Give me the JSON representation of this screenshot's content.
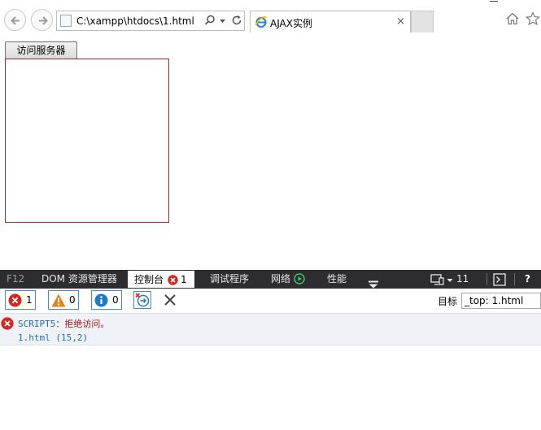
{
  "browser": {
    "address": "C:\\xampp\\htdocs\\1.html",
    "tab_title": "AJAX实例",
    "tab_close": "×"
  },
  "page": {
    "button_label": "访问服务器"
  },
  "devtools": {
    "tabs": {
      "f12": "F12",
      "dom": "DOM 资源管理器",
      "console": "控制台",
      "console_error_count": "1",
      "debugger": "调试程序",
      "network": "网络",
      "performance": "性能"
    },
    "emulation_version": "11",
    "help": "?",
    "filters": {
      "errors": "1",
      "warnings": "0",
      "info": "0"
    },
    "target_label": "目标",
    "target_value": "_top: 1.html",
    "messages": [
      {
        "level": "error",
        "code": "SCRIPT5",
        "text": "：拒绝访问。",
        "location": "1.html (15,2)"
      }
    ]
  },
  "colors": {
    "error_red": "#d9251d",
    "warning_orange": "#e8811a",
    "info_blue": "#1e7cc4",
    "devtools_bar": "#2d2d30",
    "result_border": "#a52a2a"
  }
}
